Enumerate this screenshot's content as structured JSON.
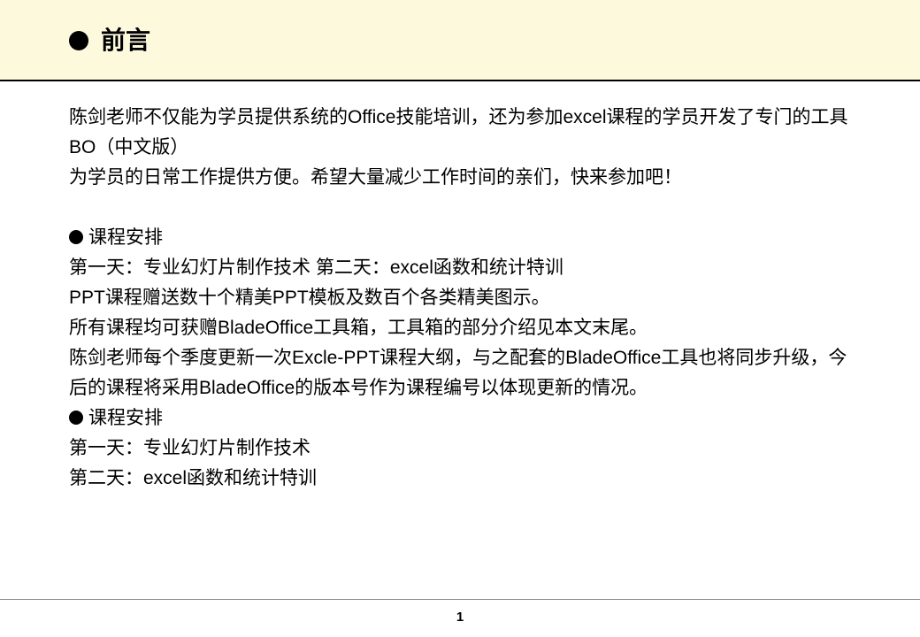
{
  "title": "前言",
  "body": {
    "p1": "陈剑老师不仅能为学员提供系统的Office技能培训，还为参加excel课程的学员开发了专门的工具BO（中文版）",
    "p2": "为学员的日常工作提供方便。希望大量减少工作时间的亲们，快来参加吧！",
    "h1": "课程安排",
    "p3": "第一天：专业幻灯片制作技术   第二天：excel函数和统计特训",
    "p4": "PPT课程赠送数十个精美PPT模板及数百个各类精美图示。",
    "p5": "所有课程均可获赠BladeOffice工具箱，工具箱的部分介绍见本文末尾。",
    "p6": "陈剑老师每个季度更新一次Excle-PPT课程大纲，与之配套的BladeOffice工具也将同步升级，今后的课程将采用BladeOffice的版本号作为课程编号以体现更新的情况。",
    "h2": "课程安排",
    "p7": "第一天：专业幻灯片制作技术",
    "p8": "第二天：excel函数和统计特训"
  },
  "page_number": "1"
}
